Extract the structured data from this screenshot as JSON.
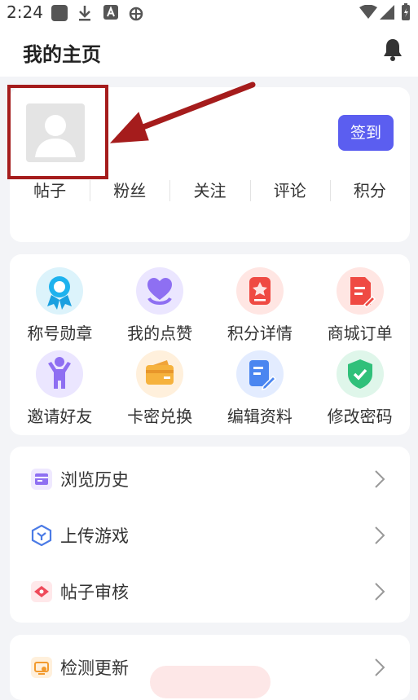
{
  "status_bar": {
    "time": "2:24"
  },
  "header": {
    "title": "我的主页"
  },
  "profile": {
    "signin_label": "签到",
    "stats": [
      "帖子",
      "粉丝",
      "关注",
      "评论",
      "积分"
    ]
  },
  "grid": {
    "items": [
      {
        "label": "称号勋章",
        "icon": "medal-icon"
      },
      {
        "label": "我的点赞",
        "icon": "heart-icon"
      },
      {
        "label": "积分详情",
        "icon": "points-icon"
      },
      {
        "label": "商城订单",
        "icon": "order-icon"
      },
      {
        "label": "邀请好友",
        "icon": "invite-icon"
      },
      {
        "label": "卡密兑换",
        "icon": "card-icon"
      },
      {
        "label": "编辑资料",
        "icon": "edit-icon"
      },
      {
        "label": "修改密码",
        "icon": "shield-icon"
      }
    ]
  },
  "menu": {
    "items": [
      {
        "label": "浏览历史",
        "icon": "history-icon"
      },
      {
        "label": "上传游戏",
        "icon": "upload-icon"
      },
      {
        "label": "帖子审核",
        "icon": "review-icon"
      }
    ]
  },
  "menu2": {
    "items": [
      {
        "label": "检测更新",
        "icon": "update-icon"
      }
    ]
  },
  "colors": {
    "accent": "#5b5ef0",
    "annotation": "#a51c1c"
  }
}
